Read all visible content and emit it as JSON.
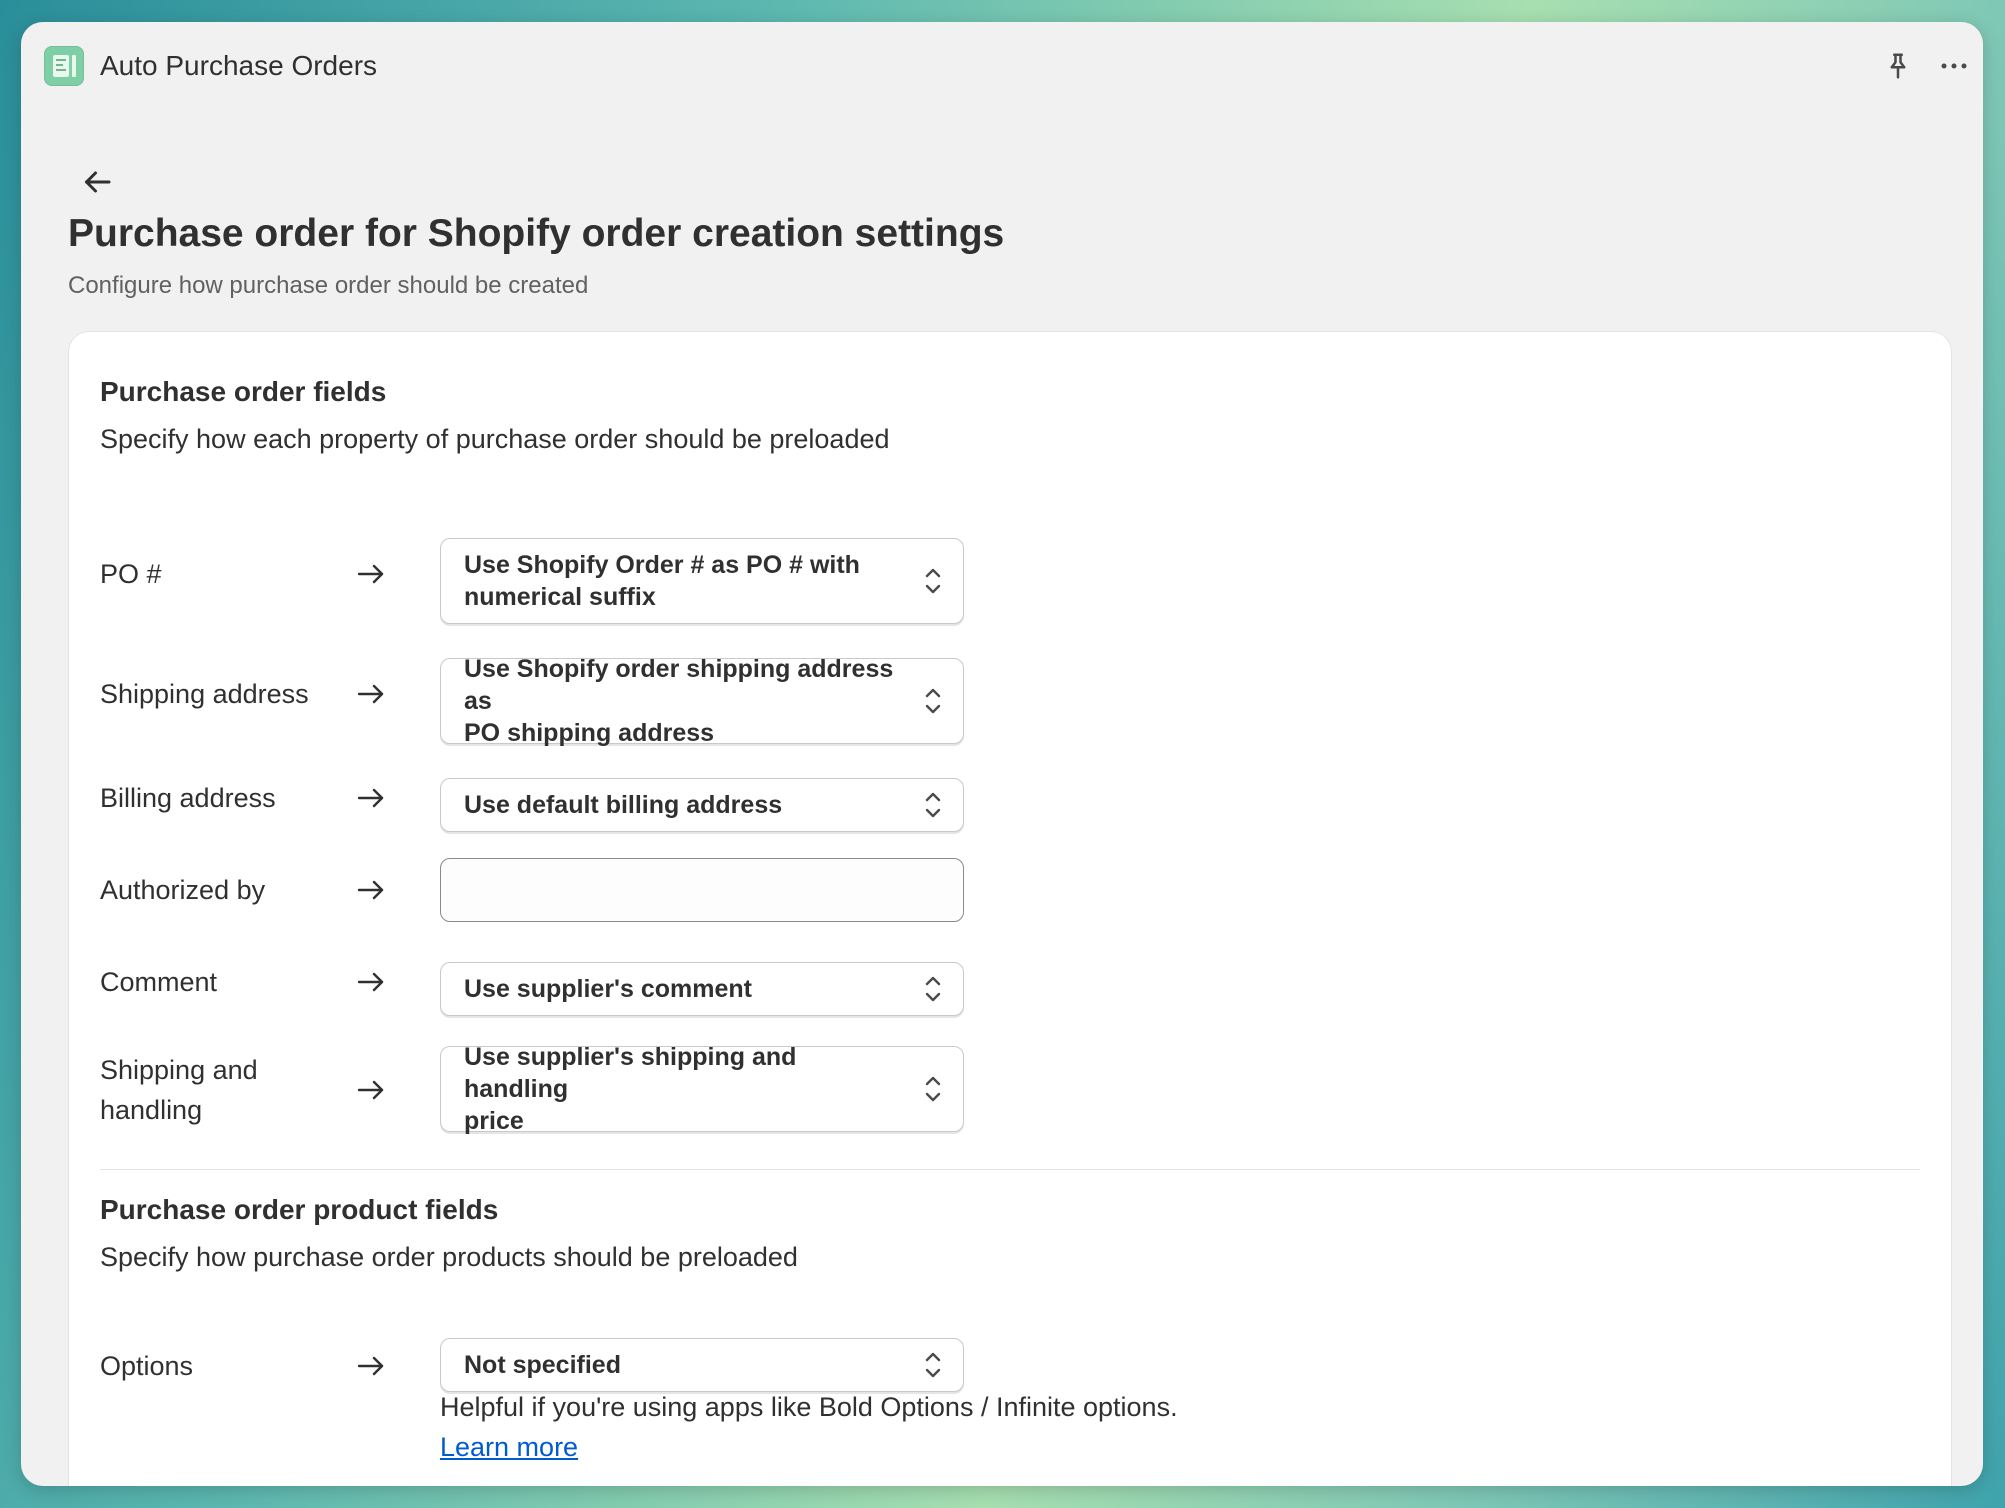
{
  "app": {
    "title": "Auto Purchase Orders"
  },
  "page": {
    "title": "Purchase order for Shopify order creation settings",
    "subtitle": "Configure how purchase order should be created"
  },
  "po_fields": {
    "title": "Purchase order fields",
    "subtitle": "Specify how each property of purchase order should be preloaded",
    "rows": [
      {
        "label": "PO #",
        "value_line1": "Use Shopify Order # as PO # with",
        "value_line2": "numerical suffix"
      },
      {
        "label": "Shipping address",
        "value_line1": "Use Shopify order shipping address as",
        "value_line2": "PO shipping address"
      },
      {
        "label": "Billing address",
        "value": "Use default billing address"
      },
      {
        "label": "Authorized by",
        "input_value": "",
        "placeholder": ""
      },
      {
        "label": "Comment",
        "value": "Use supplier's comment"
      },
      {
        "label_line1": "Shipping and",
        "label_line2": "handling",
        "value_line1": "Use supplier's shipping and handling",
        "value_line2": "price"
      }
    ]
  },
  "product_fields": {
    "title": "Purchase order product fields",
    "subtitle": "Specify how purchase order products should be preloaded",
    "options_label": "Options",
    "options_value": "Not specified",
    "help_text": "Helpful if you're using apps like Bold Options / Infinite options.",
    "learn_more": "Learn more"
  },
  "icons": [
    "app-icon",
    "pin-icon",
    "more-icon",
    "back-arrow-icon",
    "arrow-right-icon",
    "chevron-updown-icon"
  ],
  "colors": {
    "link": "#005bd3",
    "text": "#303030",
    "muted": "#616161",
    "app_icon": "#7ecfa6"
  }
}
